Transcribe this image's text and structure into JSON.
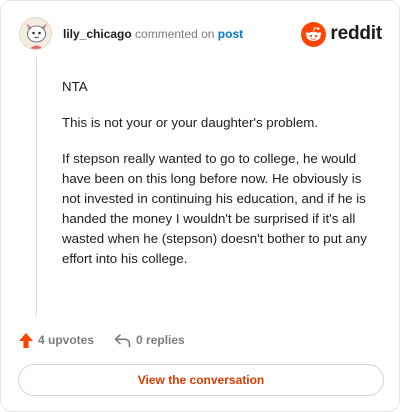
{
  "header": {
    "username": "lily_chicago",
    "action_text": "commented on",
    "post_link": "post",
    "brand": "reddit",
    "avatar_icon": "avatar-icon",
    "brand_icon": "reddit-snoo-icon"
  },
  "comment": {
    "paragraphs": [
      "NTA",
      "This is not your or your daughter's problem.",
      "If stepson really wanted to go to college, he would have been on this long before now. He obviously is not invested in continuing his education, and if he is handed the money I wouldn't be surprised if it's all wasted when he (stepson) doesn't bother to put any effort into his college."
    ]
  },
  "footer": {
    "upvotes": "4 upvotes",
    "replies": "0 replies",
    "upvote_icon": "upvote-arrow-icon",
    "reply_icon": "reply-icon",
    "cta": "View the conversation"
  },
  "colors": {
    "accent": "#ff4500",
    "cta_text": "#d93a00",
    "link": "#0079d3",
    "muted": "#7c7c7c"
  }
}
